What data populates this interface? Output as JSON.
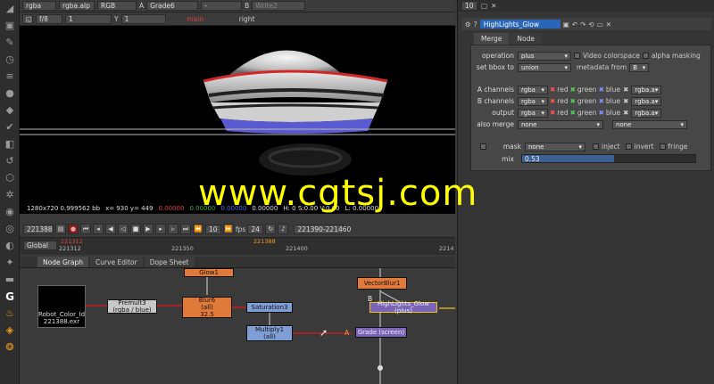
{
  "viewer_bar1": {
    "channels": "rgba",
    "alpha": "rgba.alp",
    "colorspace": "RGB",
    "a_label": "A",
    "a_input": "Grade6",
    "wipe": "-",
    "b_label": "B",
    "b_input": "Write2"
  },
  "viewer_bar2": {
    "fstop": "f/8",
    "frame": "1",
    "y_label": "Y",
    "y_value": "1",
    "view_main": "main",
    "view_right": "right"
  },
  "viewer_info": {
    "resolution": "1280x720 0.999562 bb",
    "coords": "x= 930 y= 449",
    "r": "0.00000",
    "g": "0.00000",
    "b": "0.00000",
    "a": "0.00000",
    "hsv": "H: 0 S:0.00 V:0.00",
    "l": "L: 0.00000"
  },
  "transport": {
    "frame": "221388",
    "step": "10",
    "fps_label": "fps",
    "fps": "24",
    "range": "221390-221460"
  },
  "ruler": {
    "scope": "Global",
    "in_point": "221312",
    "current": "221388",
    "ticks": [
      "221312",
      "221350",
      "221400",
      "2214"
    ]
  },
  "node_graph": {
    "tabs": [
      "Node Graph",
      "Curve Editor",
      "Dope Sheet"
    ],
    "nodes": {
      "glow1": "Glow1",
      "read_name": "Robot_Color_Id",
      "read_file": "221388.exr",
      "premult": "Premult3",
      "premult_sub": "(rgba / blue)",
      "blur": "Blur6",
      "blur_sub1": "(all)",
      "blur_sub2": "32.5",
      "saturation": "Saturation3",
      "multiply": "Multiply1",
      "multiply_sub": "(all)",
      "vectorblur": "VectorBlur1",
      "highlights": "HighLights_Glow (plus)",
      "grade": "Grade (screen)",
      "a_label": "A",
      "b_label": "B"
    }
  },
  "properties": {
    "counter": "10",
    "node_name": "HighLights_Glow",
    "tabs": [
      "Merge",
      "Node"
    ],
    "operation_label": "operation",
    "operation": "plus",
    "video_colorspace": "Video colorspace",
    "alpha_masking": "alpha masking",
    "bbox_label": "set bbox to",
    "bbox": "union",
    "metadata_label": "metadata from",
    "metadata": "B",
    "a_channels_label": "A channels",
    "b_channels_label": "B channels",
    "output_label": "output",
    "channels_value": "rgba",
    "red": "red",
    "green": "green",
    "blue": "blue",
    "alpha_chan": "rgba.a",
    "also_merge_label": "also merge",
    "also_merge": "none",
    "also_merge2": "none",
    "mask_label": "mask",
    "mask": "none",
    "inject": "inject",
    "invert": "invert",
    "fringe": "fringe",
    "mix_label": "mix",
    "mix": "0.53",
    "mix_level": 0.53
  },
  "watermark": "www.cgtsj.com"
}
